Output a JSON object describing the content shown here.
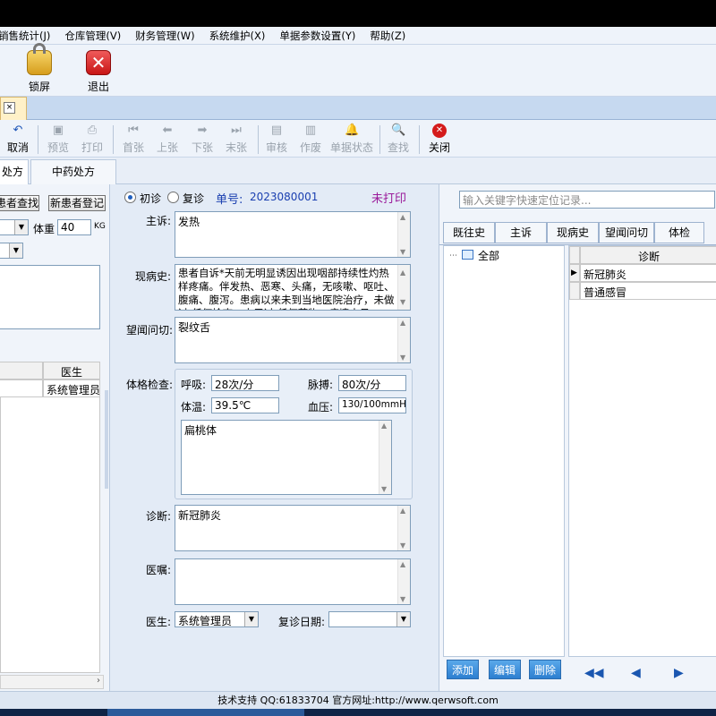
{
  "menu": [
    "销售统计(J)",
    "仓库管理(V)",
    "财务管理(W)",
    "系统维护(X)",
    "单据参数设置(Y)",
    "帮助(Z)"
  ],
  "big_toolbar": {
    "lock": "锁屏",
    "exit": "退出"
  },
  "doc_tab_close": "×",
  "toolbar": {
    "cancel": "取消",
    "preview": "预览",
    "print": "打印",
    "first": "首张",
    "prev": "上张",
    "next": "下张",
    "last": "末张",
    "audit": "审核",
    "void": "作废",
    "doc_status": "单据状态",
    "find": "查找",
    "close": "关闭"
  },
  "sub_tabs": [
    "处方",
    "中药处方"
  ],
  "left": {
    "find_patient": "患者查找",
    "new_patient": "新患者登记",
    "weight_label": "体重",
    "weight_value": "40",
    "weight_unit": "KG",
    "grid_header_doctor": "医生",
    "grid_doctor_value": "系统管理员"
  },
  "visit": {
    "first_visit": "初诊",
    "follow_up": "复诊",
    "order_label": "单号:",
    "order_no": "2023080001",
    "print_status": "未打印"
  },
  "form": {
    "complaint_label": "主诉:",
    "complaint": "发热",
    "history_label": "现病史:",
    "history": "患者自诉*天前无明显诱因出现咽部持续性灼热样疼痛。伴发热、恶寒、头痛，无咳嗽、呕吐、腹痛、腹泻。患病以来未到当地医院治疗，未做过 任何检查，未用过 任何药物，病情未见",
    "inspection_label": "望闻问切:",
    "inspection": "裂纹舌",
    "exam_label": "体格检查:",
    "respiration_label": "呼吸:",
    "respiration": "28次/分",
    "pulse_label": "脉搏:",
    "pulse": "80次/分",
    "temp_label": "体温:",
    "temp": "39.5℃",
    "bp_label": "血压:",
    "bp": "130/100mmHg",
    "exam_note": "扁桃体",
    "diagnosis_label": "诊断:",
    "diagnosis": "新冠肺炎",
    "advice_label": "医嘱:",
    "advice": "",
    "doctor_label": "医生:",
    "doctor": "系统管理员",
    "revisit_label": "复诊日期:",
    "revisit": ""
  },
  "right": {
    "search_placeholder": "输入关键字快速定位记录...",
    "tabs": [
      "既往史",
      "主诉",
      "现病史",
      "望闻问切",
      "体检"
    ],
    "tree_root": "全部",
    "grid_header": "诊断",
    "rows": [
      "新冠肺炎",
      "普通感冒"
    ],
    "add": "添加",
    "edit": "编辑",
    "delete": "删除"
  },
  "status_bar": "技术支持 QQ:61833704 官方网址:http://www.qerwsoft.com",
  "colors": {
    "accent_blue": "#1a3fb0",
    "print_status": "#9a1a9a",
    "button_blue": "#2c7fd0"
  }
}
